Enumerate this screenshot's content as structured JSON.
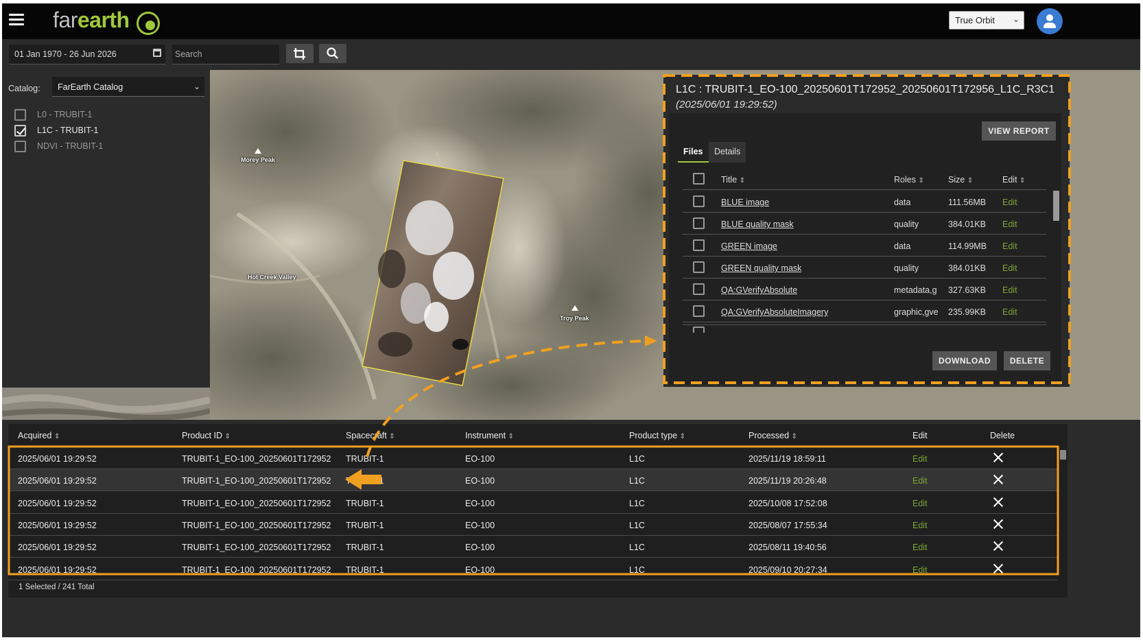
{
  "header": {
    "logo_far": "far",
    "logo_earth": "earth",
    "orbit_select_value": "True Orbit",
    "accent_color": "#a0c83c"
  },
  "toolbar": {
    "date_range": "01 Jan 1970 - 26 Jun 2026",
    "search_placeholder": "Search",
    "crop_icon": "crop-icon",
    "search_icon": "search-icon"
  },
  "sidebar": {
    "catalog_label": "Catalog:",
    "catalog_value": "FarEarth Catalog",
    "items": [
      {
        "label": "L0 - TRUBIT-1",
        "checked": false
      },
      {
        "label": "L1C - TRUBIT-1",
        "checked": true
      },
      {
        "label": "NDVI - TRUBIT-1",
        "checked": false
      }
    ]
  },
  "map": {
    "labels": [
      "Morey Peak",
      "Hot Creek Valley",
      "Troy Peak"
    ]
  },
  "detail": {
    "title": "L1C : TRUBIT-1_EO-100_20250601T172952_20250601T172956_L1C_R3C1",
    "subtitle": "(2025/06/01 19:29:52)",
    "view_report": "VIEW REPORT",
    "tabs": [
      "Files",
      "Details"
    ],
    "columns": {
      "title": "Title",
      "roles": "Roles",
      "size": "Size",
      "edit": "Edit"
    },
    "files": [
      {
        "title": "BLUE image",
        "roles": "data",
        "size": "111.56MB",
        "edit": "Edit"
      },
      {
        "title": "BLUE quality mask",
        "roles": "quality",
        "size": "384.01KB",
        "edit": "Edit"
      },
      {
        "title": "GREEN image",
        "roles": "data",
        "size": "114.99MB",
        "edit": "Edit"
      },
      {
        "title": "GREEN quality mask",
        "roles": "quality",
        "size": "384.01KB",
        "edit": "Edit"
      },
      {
        "title": "QA:GVerifyAbsolute",
        "roles": "metadata,g",
        "size": "327.63KB",
        "edit": "Edit"
      },
      {
        "title": "QA:GVerifyAbsoluteImagery",
        "roles": "graphic,gve",
        "size": "235.99KB",
        "edit": "Edit"
      }
    ],
    "download": "DOWNLOAD",
    "delete": "DELETE"
  },
  "results": {
    "columns": {
      "acquired": "Acquired",
      "product_id": "Product ID",
      "spacecraft": "Spacecraft",
      "instrument": "Instrument",
      "product_type": "Product type",
      "processed": "Processed",
      "edit": "Edit",
      "delete": "Delete"
    },
    "rows": [
      {
        "acquired": "2025/06/01 19:29:52",
        "product_id": "TRUBIT-1_EO-100_20250601T172952",
        "spacecraft": "TRUBIT-1",
        "instrument": "EO-100",
        "product_type": "L1C",
        "processed": "2025/11/19 18:59:11",
        "edit": "Edit"
      },
      {
        "acquired": "2025/06/01 19:29:52",
        "product_id": "TRUBIT-1_EO-100_20250601T172952",
        "spacecraft": "TRUBIT-1",
        "instrument": "EO-100",
        "product_type": "L1C",
        "processed": "2025/11/19 20:26:48",
        "edit": "Edit"
      },
      {
        "acquired": "2025/06/01 19:29:52",
        "product_id": "TRUBIT-1_EO-100_20250601T172952",
        "spacecraft": "TRUBIT-1",
        "instrument": "EO-100",
        "product_type": "L1C",
        "processed": "2025/10/08 17:52:08",
        "edit": "Edit"
      },
      {
        "acquired": "2025/06/01 19:29:52",
        "product_id": "TRUBIT-1_EO-100_20250601T172952",
        "spacecraft": "TRUBIT-1",
        "instrument": "EO-100",
        "product_type": "L1C",
        "processed": "2025/08/07 17:55:34",
        "edit": "Edit"
      },
      {
        "acquired": "2025/06/01 19:29:52",
        "product_id": "TRUBIT-1_EO-100_20250601T172952",
        "spacecraft": "TRUBIT-1",
        "instrument": "EO-100",
        "product_type": "L1C",
        "processed": "2025/08/11 19:40:56",
        "edit": "Edit"
      },
      {
        "acquired": "2025/06/01 19:29:52",
        "product_id": "TRUBIT-1_EO-100_20250601T172952",
        "spacecraft": "TRUBIT-1",
        "instrument": "EO-100",
        "product_type": "L1C",
        "processed": "2025/09/10 20:27:34",
        "edit": "Edit"
      }
    ],
    "status": "1 Selected / 241 Total"
  },
  "annotation_color": "#f0a020"
}
